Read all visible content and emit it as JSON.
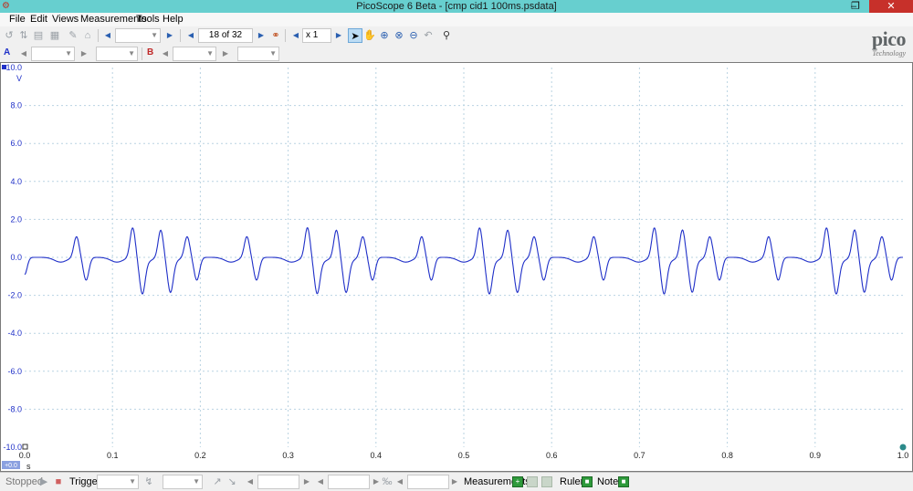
{
  "window": {
    "title": "PicoScope 6 Beta - [cmp cid1 100ms.psdata]",
    "minimize_glyph": "–",
    "restore_glyph": "❐",
    "close_glyph": "✕"
  },
  "menu": {
    "items": [
      "File",
      "Edit",
      "Views",
      "Measurements",
      "Tools",
      "Help"
    ]
  },
  "toolbar": {
    "buffer_position": "18 of 32",
    "zoom_value": "x 1"
  },
  "channels": {
    "a_label": "A",
    "b_label": "B"
  },
  "logo": {
    "word": "pico",
    "sub": "Technology"
  },
  "plot": {
    "y_unit": "V",
    "x_unit": "s",
    "x_offset_badge": "+0.0",
    "y_ticks": [
      "10.0",
      "8.0",
      "6.0",
      "4.0",
      "2.0",
      "0.0",
      "-2.0",
      "-4.0",
      "-6.0",
      "-8.0",
      "-10.0"
    ],
    "x_ticks": [
      "0.0",
      "0.1",
      "0.2",
      "0.3",
      "0.4",
      "0.5",
      "0.6",
      "0.7",
      "0.8",
      "0.9",
      "1.0"
    ],
    "trace_color": "#1f2fc8",
    "grid_color": "#b9d3e2"
  },
  "chart_data": {
    "type": "line",
    "x_range": [
      0.0,
      1.0
    ],
    "y_range": [
      -10.0,
      10.0
    ],
    "grid": true,
    "series": [
      {
        "pulse_times": [
          0.059,
          0.123,
          0.155,
          0.185,
          0.253,
          0.322,
          0.355,
          0.385,
          0.452,
          0.518,
          0.55,
          0.58,
          0.648,
          0.717,
          0.749,
          0.78,
          0.847,
          0.913,
          0.945,
          0.976
        ],
        "pulse_peaks": [
          1.1,
          1.6,
          1.5,
          1.1,
          1.1,
          1.6,
          1.5,
          1.1,
          1.1,
          1.6,
          1.5,
          1.1,
          1.1,
          1.6,
          1.5,
          1.1,
          1.1,
          1.6,
          1.5,
          1.1
        ],
        "pulse_troughs": [
          -1.2,
          -1.7,
          -1.6,
          -1.2,
          -1.2,
          -1.7,
          -1.6,
          -1.2,
          -1.2,
          -1.7,
          -1.6,
          -1.2,
          -1.2,
          -1.7,
          -1.6,
          -1.2,
          -1.2,
          -1.7,
          -1.6,
          -1.2
        ],
        "baseline": 0.0
      }
    ]
  },
  "status": {
    "state": "Stopped",
    "trigger_label": "Trigger",
    "measurements_label": "Measurements",
    "rulers_label": "Rulers",
    "notes_label": "Notes"
  }
}
